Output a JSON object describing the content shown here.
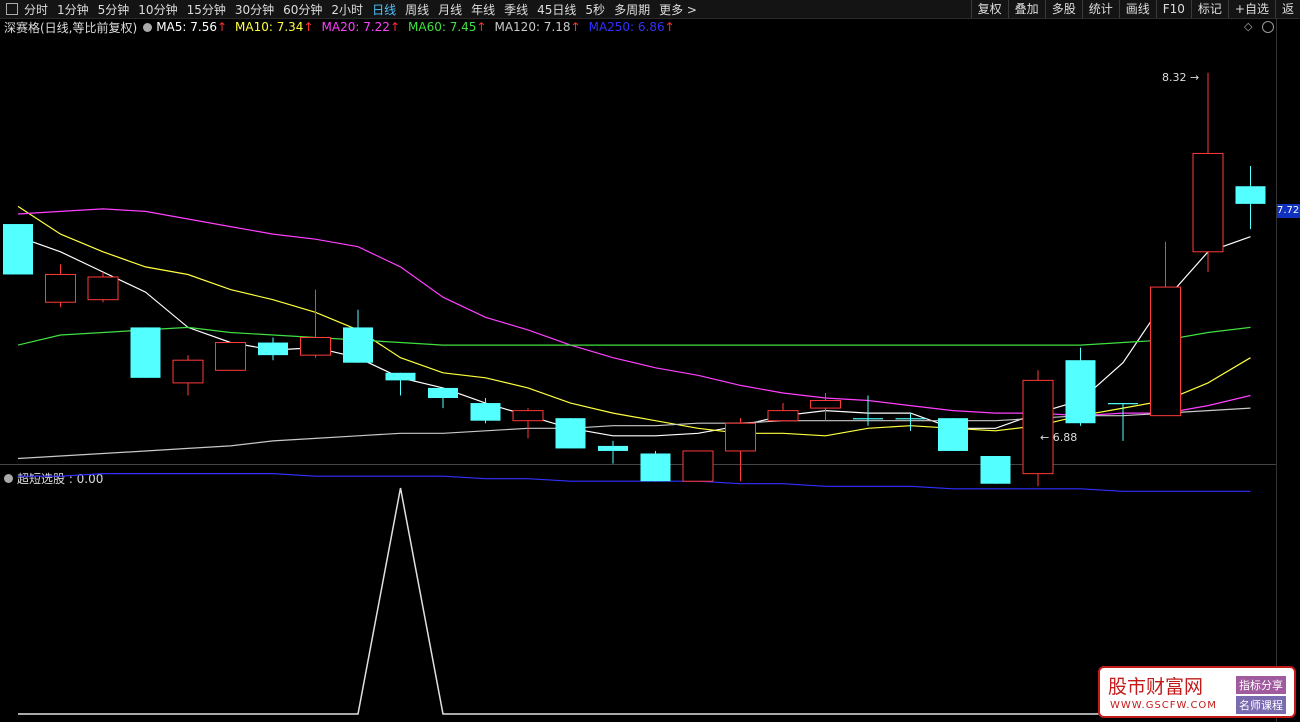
{
  "toolbar": {
    "periods": [
      "分时",
      "1分钟",
      "5分钟",
      "10分钟",
      "15分钟",
      "30分钟",
      "60分钟",
      "2小时",
      "日线",
      "周线",
      "月线",
      "年线",
      "季线",
      "45日线",
      "5秒",
      "多周期",
      "更多 >"
    ],
    "active_period": "日线",
    "tools": [
      "复权",
      "叠加",
      "多股",
      "统计",
      "画线",
      "F10",
      "标记",
      "+自选",
      "返"
    ]
  },
  "legend": {
    "title": "深赛格(日线,等比前复权)",
    "ma": [
      {
        "label": "MA5: 7.56",
        "color": "#ffffff"
      },
      {
        "label": "MA10: 7.34",
        "color": "#ffff40"
      },
      {
        "label": "MA20: 7.22",
        "color": "#ff40ff"
      },
      {
        "label": "MA60: 7.45",
        "color": "#40e040"
      },
      {
        "label": "MA120: 7.18",
        "color": "#c8c8c8"
      },
      {
        "label": "MA250: 6.86",
        "color": "#3030ff"
      }
    ],
    "arrow": "↑"
  },
  "price_tag": "7.72",
  "indicator": {
    "label": "超短选股 : 0.00"
  },
  "watermark": {
    "name": "股市财富网",
    "url": "WWW.GSCFW.COM",
    "tag1": "指标分享",
    "tag2": "名师课程"
  },
  "chart_data": {
    "type": "candlestick",
    "ylim": [
      6.8,
      8.45
    ],
    "colors": {
      "up": "#ff3a3a",
      "down": "#54ffff"
    },
    "candles": [
      {
        "o": 7.72,
        "c": 7.52,
        "h": 7.72,
        "l": 7.52
      },
      {
        "o": 7.41,
        "c": 7.52,
        "h": 7.56,
        "l": 7.39
      },
      {
        "o": 7.42,
        "c": 7.51,
        "h": 7.53,
        "l": 7.41
      },
      {
        "o": 7.31,
        "c": 7.11,
        "h": 7.31,
        "l": 7.11
      },
      {
        "o": 7.09,
        "c": 7.18,
        "h": 7.2,
        "l": 7.04
      },
      {
        "o": 7.14,
        "c": 7.25,
        "h": 7.25,
        "l": 7.14
      },
      {
        "o": 7.25,
        "c": 7.2,
        "h": 7.27,
        "l": 7.18
      },
      {
        "o": 7.2,
        "c": 7.27,
        "h": 7.46,
        "l": 7.19
      },
      {
        "o": 7.31,
        "c": 7.17,
        "h": 7.38,
        "l": 7.17
      },
      {
        "o": 7.13,
        "c": 7.1,
        "h": 7.13,
        "l": 7.04
      },
      {
        "o": 7.07,
        "c": 7.03,
        "h": 7.07,
        "l": 6.99
      },
      {
        "o": 7.01,
        "c": 6.94,
        "h": 7.03,
        "l": 6.93
      },
      {
        "o": 6.94,
        "c": 6.98,
        "h": 6.99,
        "l": 6.87
      },
      {
        "o": 6.95,
        "c": 6.83,
        "h": 6.95,
        "l": 6.83
      },
      {
        "o": 6.84,
        "c": 6.82,
        "h": 6.86,
        "l": 6.77
      },
      {
        "o": 6.81,
        "c": 6.7,
        "h": 6.82,
        "l": 6.7
      },
      {
        "o": 6.7,
        "c": 6.82,
        "h": 6.82,
        "l": 6.7
      },
      {
        "o": 6.82,
        "c": 6.93,
        "h": 6.95,
        "l": 6.7
      },
      {
        "o": 6.94,
        "c": 6.98,
        "h": 7.01,
        "l": 6.94
      },
      {
        "o": 6.99,
        "c": 7.02,
        "h": 7.05,
        "l": 6.94
      },
      {
        "o": 6.95,
        "c": 6.95,
        "h": 7.04,
        "l": 6.92
      },
      {
        "o": 6.95,
        "c": 6.95,
        "h": 6.97,
        "l": 6.9
      },
      {
        "o": 6.95,
        "c": 6.82,
        "h": 6.95,
        "l": 6.82
      },
      {
        "o": 6.8,
        "c": 6.69,
        "h": 6.8,
        "l": 6.69
      },
      {
        "o": 6.73,
        "c": 7.1,
        "h": 7.14,
        "l": 6.68
      },
      {
        "o": 7.18,
        "c": 6.93,
        "h": 7.23,
        "l": 6.92
      },
      {
        "o": 7.01,
        "c": 7.01,
        "h": 7.01,
        "l": 6.86
      },
      {
        "o": 6.96,
        "c": 7.47,
        "h": 7.65,
        "l": 6.96
      },
      {
        "o": 7.61,
        "c": 8.0,
        "h": 8.32,
        "l": 7.53
      },
      {
        "o": 7.87,
        "c": 7.8,
        "h": 7.95,
        "l": 7.7
      }
    ],
    "annotations": [
      {
        "text": "8.32",
        "value": 8.32
      },
      {
        "text": "6.88",
        "value": 6.88
      }
    ],
    "ma_lines": [
      {
        "name": "MA5",
        "color": "#ffffff",
        "values": [
          7.67,
          7.61,
          7.53,
          7.45,
          7.31,
          7.25,
          7.22,
          7.23,
          7.19,
          7.11,
          7.07,
          7.01,
          6.96,
          6.91,
          6.88,
          6.88,
          6.89,
          6.92,
          6.96,
          6.98,
          6.97,
          6.97,
          6.91,
          6.91,
          6.97,
          7.02,
          7.17,
          7.42,
          7.61,
          7.67
        ]
      },
      {
        "name": "MA10",
        "color": "#ffff40",
        "values": [
          7.79,
          7.68,
          7.61,
          7.55,
          7.52,
          7.46,
          7.42,
          7.37,
          7.3,
          7.19,
          7.13,
          7.11,
          7.07,
          7.01,
          6.97,
          6.94,
          6.91,
          6.89,
          6.89,
          6.88,
          6.91,
          6.92,
          6.91,
          6.9,
          6.92,
          6.96,
          6.99,
          7.02,
          7.09,
          7.19
        ]
      },
      {
        "name": "MA20",
        "color": "#ff40ff",
        "values": [
          7.76,
          7.77,
          7.78,
          7.77,
          7.74,
          7.71,
          7.68,
          7.66,
          7.63,
          7.55,
          7.43,
          7.35,
          7.3,
          7.24,
          7.19,
          7.15,
          7.12,
          7.08,
          7.05,
          7.03,
          7.02,
          7.0,
          6.98,
          6.97,
          6.97,
          6.96,
          6.97,
          6.97,
          7.0,
          7.04
        ]
      },
      {
        "name": "MA60",
        "color": "#40e040",
        "values": [
          7.24,
          7.28,
          7.29,
          7.3,
          7.31,
          7.29,
          7.28,
          7.27,
          7.26,
          7.25,
          7.24,
          7.24,
          7.24,
          7.24,
          7.24,
          7.24,
          7.24,
          7.24,
          7.24,
          7.24,
          7.24,
          7.24,
          7.24,
          7.24,
          7.24,
          7.24,
          7.25,
          7.26,
          7.29,
          7.31
        ]
      },
      {
        "name": "MA120",
        "color": "#c8c8c8",
        "values": [
          6.79,
          6.8,
          6.81,
          6.82,
          6.83,
          6.84,
          6.86,
          6.87,
          6.88,
          6.89,
          6.89,
          6.9,
          6.91,
          6.91,
          6.92,
          6.92,
          6.93,
          6.93,
          6.94,
          6.94,
          6.94,
          6.94,
          6.94,
          6.94,
          6.95,
          6.96,
          6.96,
          6.97,
          6.98,
          6.99
        ]
      },
      {
        "name": "MA250",
        "color": "#3030ff",
        "values": [
          6.72,
          6.72,
          6.73,
          6.73,
          6.73,
          6.73,
          6.73,
          6.72,
          6.72,
          6.72,
          6.72,
          6.71,
          6.71,
          6.7,
          6.7,
          6.7,
          6.7,
          6.69,
          6.69,
          6.68,
          6.68,
          6.68,
          6.67,
          6.67,
          6.67,
          6.67,
          6.66,
          6.66,
          6.66,
          6.66
        ]
      }
    ],
    "indicator_series": {
      "name": "超短选股",
      "ylim": [
        0,
        1
      ],
      "values": [
        0,
        0,
        0,
        0,
        0,
        0,
        0,
        0,
        0,
        1,
        0,
        0,
        0,
        0,
        0,
        0,
        0,
        0,
        0,
        0,
        0,
        0,
        0,
        0,
        0,
        0,
        0,
        0,
        0,
        0
      ]
    }
  }
}
